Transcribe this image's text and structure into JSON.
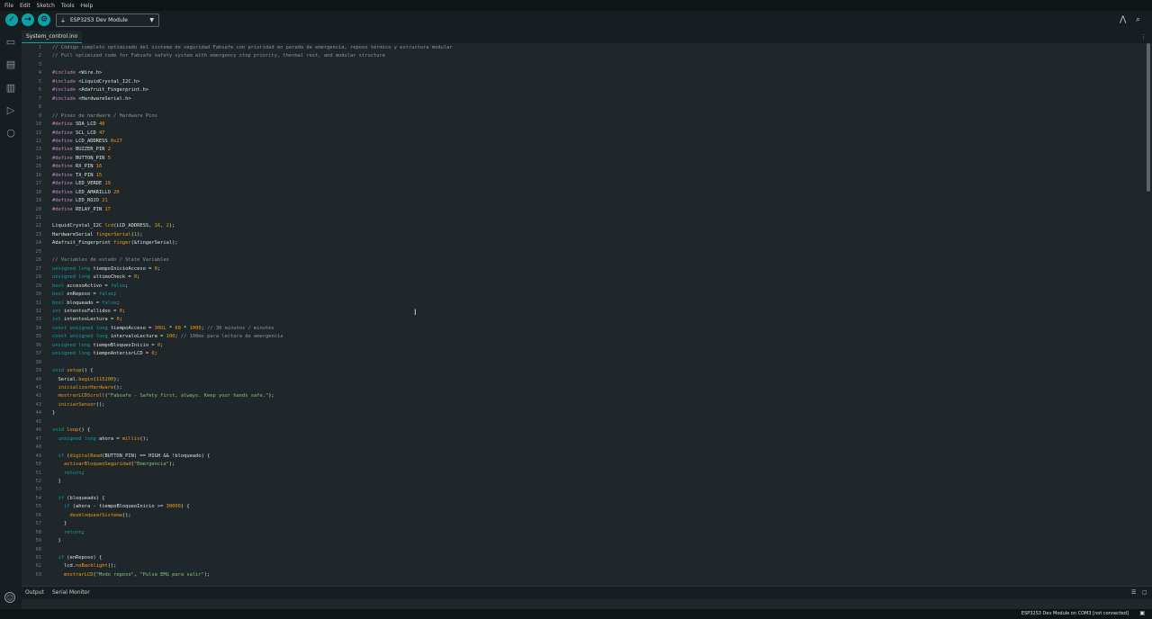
{
  "menu": [
    "File",
    "Edit",
    "Sketch",
    "Tools",
    "Help"
  ],
  "toolbar": {
    "verify_icon": "check-icon",
    "upload_icon": "arrow-right-icon",
    "debug_icon": "debug-icon",
    "board": "ESP32S3 Dev Module",
    "serial_plotter_icon": "serial-plotter-icon",
    "serial_monitor_icon": "serial-monitor-icon"
  },
  "sidebar": [
    "folder-icon",
    "boards-manager-icon",
    "library-icon",
    "debug-run-icon",
    "search-icon"
  ],
  "tab": {
    "name": "System_control.ino"
  },
  "code": [
    "// Código completo optimizado del sistema de seguridad Fabsafe con prioridad en parada de emergencia, reposo térmico y estructura modular",
    "// Full optimized code for Fabsafe safety system with emergency stop priority, thermal rest, and modular structure",
    "",
    "#include <Wire.h>",
    "#include <LiquidCrystal_I2C.h>",
    "#include <Adafruit_Fingerprint.h>",
    "#include <HardwareSerial.h>",
    "",
    "// Pines de hardware / Hardware Pins",
    "#define SDA_LCD 48",
    "#define SCL_LCD 47",
    "#define LCD_ADDRESS 0x27",
    "#define BUZZER_PIN 2",
    "#define BUTTON_PIN 5",
    "#define RX_PIN 16",
    "#define TX_PIN 15",
    "#define LED_VERDE 19",
    "#define LED_AMARILLO 20",
    "#define LED_ROJO 21",
    "#define RELAY_PIN 17",
    "",
    "LiquidCrystal_I2C lcd(LCD_ADDRESS, 16, 2);",
    "HardwareSerial fingerSerial(1);",
    "Adafruit_Fingerprint finger(&fingerSerial);",
    "",
    "// Variables de estado / State Variables",
    "unsigned long tiempoInicioAcceso = 0;",
    "unsigned long ultimoCheck = 0;",
    "bool accesoActivo = false;",
    "bool enReposo = false;",
    "bool bloqueado = false;",
    "int intentosFallidos = 0;",
    "int intentosLectura = 0;",
    "const unsigned long tiempoAcceso = 30UL * 60 * 1000; // 30 minutos / minutes",
    "const unsigned long intervaloLectura = 100; // 100ms para lectura de emergencia",
    "unsigned long tiempoBloqueoInicio = 0;",
    "unsigned long tiempoAnteriorLCD = 0;",
    "",
    "void setup() {",
    "  Serial.begin(115200);",
    "  inicializarHardware();",
    "  mostrarLCDScroll(\"Fabsafe - Safety first, always. Keep your hands safe.\");",
    "  iniciarSensor();",
    "}",
    "",
    "void loop() {",
    "  unsigned long ahora = millis();",
    "",
    "  if (digitalRead(BUTTON_PIN) == HIGH && !bloqueado) {",
    "    activarBloqueoSeguridad(\"Emergencia\");",
    "    return;",
    "  }",
    "",
    "  if (bloqueado) {",
    "    if (ahora - tiempoBloqueoInicio >= 30000) {",
    "      desbloquearSistema();",
    "    }",
    "    return;",
    "  }",
    "",
    "  if (enReposo) {",
    "    lcd.noBacklight();",
    "    mostrarLCD(\"Modo reposo\", \"Pulsa EMG para salir\");"
  ],
  "panel": {
    "output": "Output",
    "serial_monitor": "Serial Monitor"
  },
  "status": {
    "text": "ESP32S3 Dev Module on COM3 [not connected]"
  },
  "colors": {
    "accent": "#0ca1a6",
    "background": "#1f272a",
    "keyword": "#0ca1a6",
    "number": "#f39c12",
    "comment": "#8a9699"
  }
}
